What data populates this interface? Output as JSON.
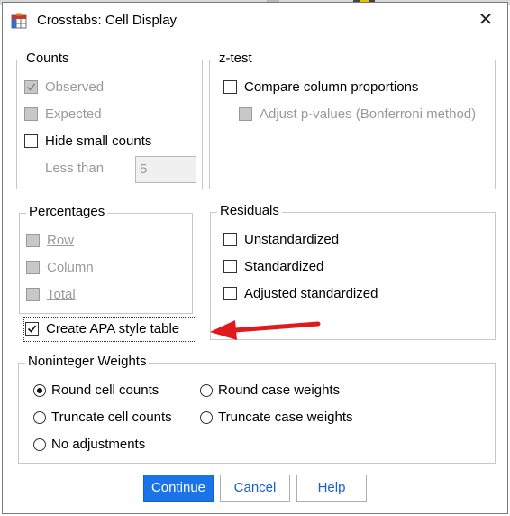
{
  "window": {
    "title": "Crosstabs: Cell Display",
    "close_glyph": "✕"
  },
  "counts": {
    "title": "Counts",
    "observed": "Observed",
    "expected": "Expected",
    "hide_small": "Hide small counts",
    "less_than_label": "Less than",
    "less_than_value": "5"
  },
  "ztest": {
    "title": "z-test",
    "compare": "Compare column proportions",
    "adjust": "Adjust p-values (Bonferroni method)"
  },
  "percentages": {
    "title": "Percentages",
    "row": "Row",
    "column": "Column",
    "total": "Total"
  },
  "residuals": {
    "title": "Residuals",
    "unstandardized": "Unstandardized",
    "standardized": "Standardized",
    "adjusted": "Adjusted standardized"
  },
  "apa": {
    "label": "Create APA style table"
  },
  "weights": {
    "title": "Noninteger Weights",
    "round_cell": "Round cell counts",
    "round_case": "Round case weights",
    "truncate_cell": "Truncate cell counts",
    "truncate_case": "Truncate case weights",
    "no_adjust": "No adjustments"
  },
  "buttons": {
    "continue": "Continue",
    "cancel": "Cancel",
    "help": "Help"
  },
  "colors": {
    "accent": "#1a73e8",
    "arrow": "#e0191e",
    "disabled": "#9a9a9a"
  }
}
